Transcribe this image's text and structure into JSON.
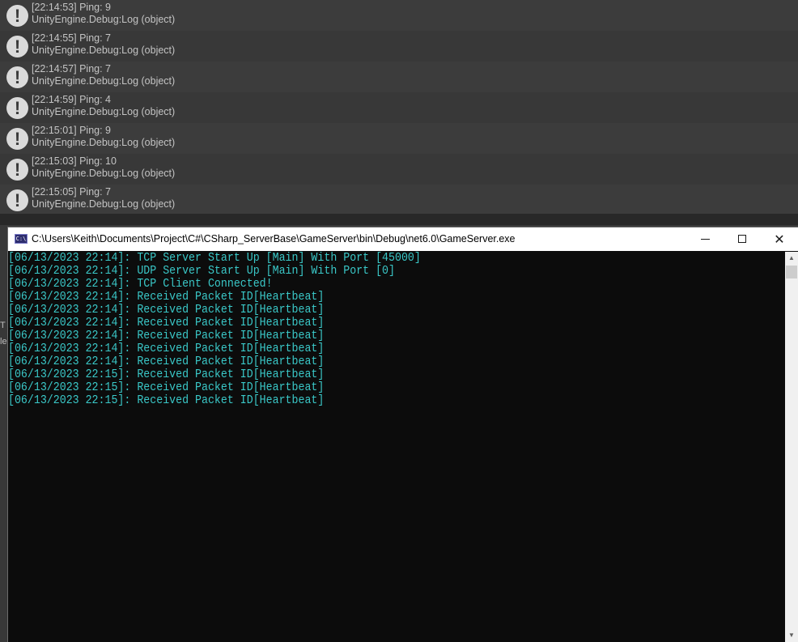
{
  "unity_console": {
    "logs": [
      {
        "message": "[22:14:53] Ping: 9",
        "source": "UnityEngine.Debug:Log (object)"
      },
      {
        "message": "[22:14:55] Ping: 7",
        "source": "UnityEngine.Debug:Log (object)"
      },
      {
        "message": "[22:14:57] Ping: 7",
        "source": "UnityEngine.Debug:Log (object)"
      },
      {
        "message": "[22:14:59] Ping: 4",
        "source": "UnityEngine.Debug:Log (object)"
      },
      {
        "message": "[22:15:01] Ping: 9",
        "source": "UnityEngine.Debug:Log (object)"
      },
      {
        "message": "[22:15:03] Ping: 10",
        "source": "UnityEngine.Debug:Log (object)"
      },
      {
        "message": "[22:15:05] Ping: 7",
        "source": "UnityEngine.Debug:Log (object)"
      }
    ],
    "icon": "warning-exclamation-icon",
    "behind_text": [
      "T",
      "le"
    ]
  },
  "console_window": {
    "title": "C:\\Users\\Keith\\Documents\\Project\\C#\\CSharp_ServerBase\\GameServer\\bin\\Debug\\net6.0\\GameServer.exe",
    "app_icon_text": "C:\\",
    "buttons": {
      "minimize": "minimize-icon",
      "maximize": "maximize-icon",
      "close": "✕"
    },
    "text_color": "#3ac8c8",
    "background_color": "#0c0c0c",
    "output": [
      "[06/13/2023 22:14]: TCP Server Start Up [Main] With Port [45000]",
      "[06/13/2023 22:14]: UDP Server Start Up [Main] With Port [0]",
      "[06/13/2023 22:14]: TCP Client Connected!",
      "[06/13/2023 22:14]: Received Packet ID[Heartbeat]",
      "[06/13/2023 22:14]: Received Packet ID[Heartbeat]",
      "[06/13/2023 22:14]: Received Packet ID[Heartbeat]",
      "[06/13/2023 22:14]: Received Packet ID[Heartbeat]",
      "[06/13/2023 22:14]: Received Packet ID[Heartbeat]",
      "[06/13/2023 22:14]: Received Packet ID[Heartbeat]",
      "[06/13/2023 22:15]: Received Packet ID[Heartbeat]",
      "[06/13/2023 22:15]: Received Packet ID[Heartbeat]",
      "[06/13/2023 22:15]: Received Packet ID[Heartbeat]"
    ],
    "scrollbar": {
      "up_arrow": "▲",
      "down_arrow": "▼"
    }
  }
}
